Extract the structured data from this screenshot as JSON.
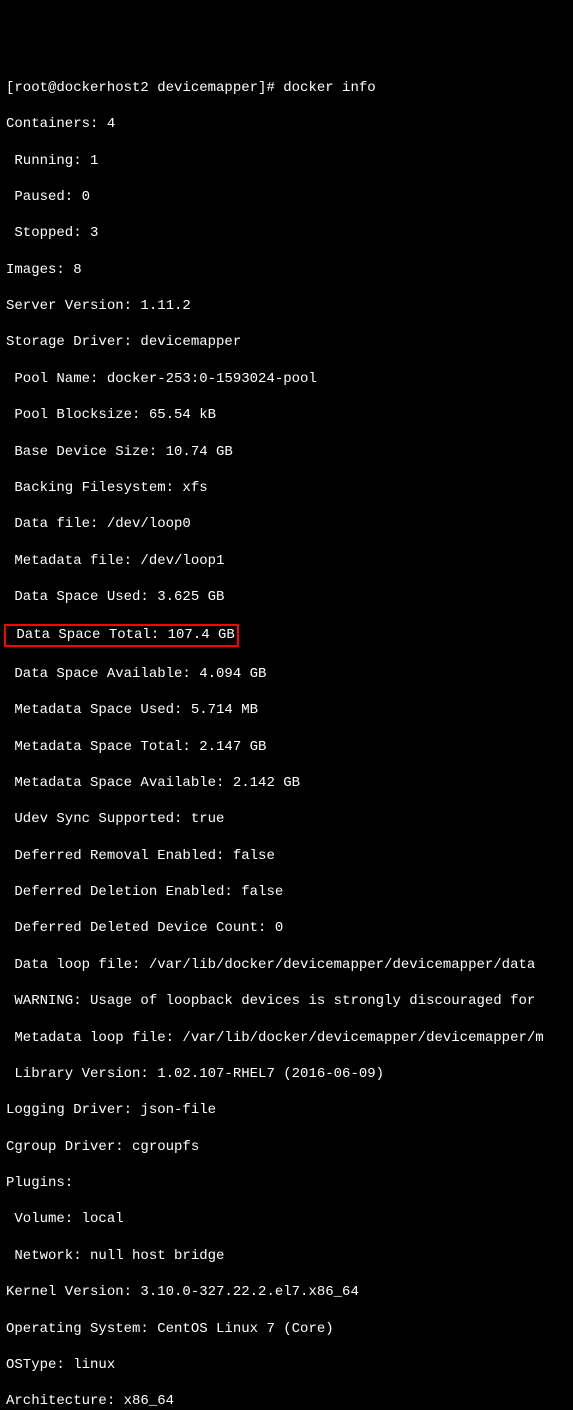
{
  "prompt": "[root@dockerhost2 devicemapper]# docker info",
  "lines": {
    "containers": "Containers: 4",
    "running": " Running: 1",
    "paused": " Paused: 0",
    "stopped": " Stopped: 3",
    "images": "Images: 8",
    "server_version": "Server Version: 1.11.2",
    "storage_driver": "Storage Driver: devicemapper",
    "pool_name": " Pool Name: docker-253:0-1593024-pool",
    "pool_blocksize": " Pool Blocksize: 65.54 kB",
    "base_device_size": " Base Device Size: 10.74 GB",
    "backing_fs": " Backing Filesystem: xfs",
    "data_file": " Data file: /dev/loop0",
    "metadata_file": " Metadata file: /dev/loop1",
    "data_space_used": " Data Space Used: 3.625 GB",
    "data_space_total": " Data Space Total: 107.4 GB",
    "data_space_avail": " Data Space Available: 4.094 GB",
    "metadata_space_used": " Metadata Space Used: 5.714 MB",
    "metadata_space_total": " Metadata Space Total: 2.147 GB",
    "metadata_space_avail": " Metadata Space Available: 2.142 GB",
    "udev_sync": " Udev Sync Supported: true",
    "deferred_removal": " Deferred Removal Enabled: false",
    "deferred_deletion": " Deferred Deletion Enabled: false",
    "deferred_deleted_count": " Deferred Deleted Device Count: 0",
    "data_loop_file": " Data loop file: /var/lib/docker/devicemapper/devicemapper/data",
    "warning": " WARNING: Usage of loopback devices is strongly discouraged for ",
    "metadata_loop_file": " Metadata loop file: /var/lib/docker/devicemapper/devicemapper/m",
    "library_version": " Library Version: 1.02.107-RHEL7 (2016-06-09)",
    "logging_driver": "Logging Driver: json-file",
    "cgroup_driver": "Cgroup Driver: cgroupfs",
    "plugins": "Plugins:",
    "volume": " Volume: local",
    "network": " Network: null host bridge",
    "kernel_version": "Kernel Version: 3.10.0-327.22.2.el7.x86_64",
    "operating_system": "Operating System: CentOS Linux 7 (Core)",
    "ostype": "OSType: linux",
    "architecture": "Architecture: x86_64"
  }
}
